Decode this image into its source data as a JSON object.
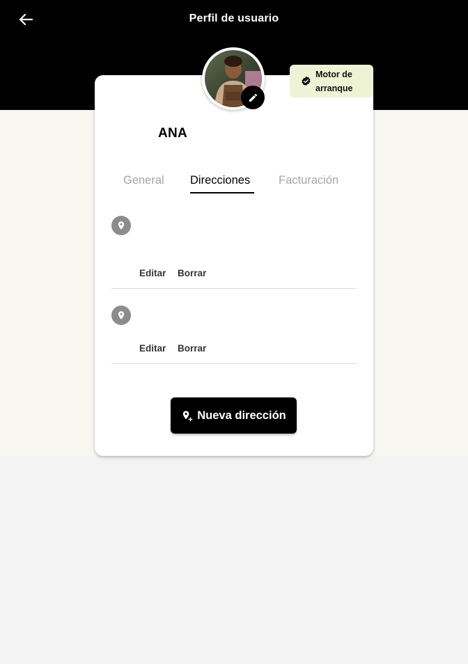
{
  "header": {
    "title": "Perfil de usuario",
    "back_icon": "arrow-left-icon"
  },
  "profile": {
    "name": "ANA",
    "avatar_edit_icon": "pencil-icon",
    "badge": {
      "icon": "verified-check-icon",
      "line1": "Motor de",
      "line2": "arranque",
      "background": "#eef3d6"
    }
  },
  "tabs": [
    {
      "label": "General",
      "active": false
    },
    {
      "label": "Direcciones",
      "active": true
    },
    {
      "label": "Facturación",
      "active": false
    }
  ],
  "addresses": [
    {
      "icon": "location-pin-icon",
      "edit_label": "Editar",
      "delete_label": "Borrar"
    },
    {
      "icon": "location-pin-icon",
      "edit_label": "Editar",
      "delete_label": "Borrar"
    }
  ],
  "new_address_button": {
    "label": "Nueva dirección",
    "icon": "add-location-icon"
  },
  "colors": {
    "header_bg": "#000000",
    "content_bg": "#f7f6f1",
    "pin_gray": "#8c8c8c",
    "inactive_tab": "#a6a6a6"
  }
}
